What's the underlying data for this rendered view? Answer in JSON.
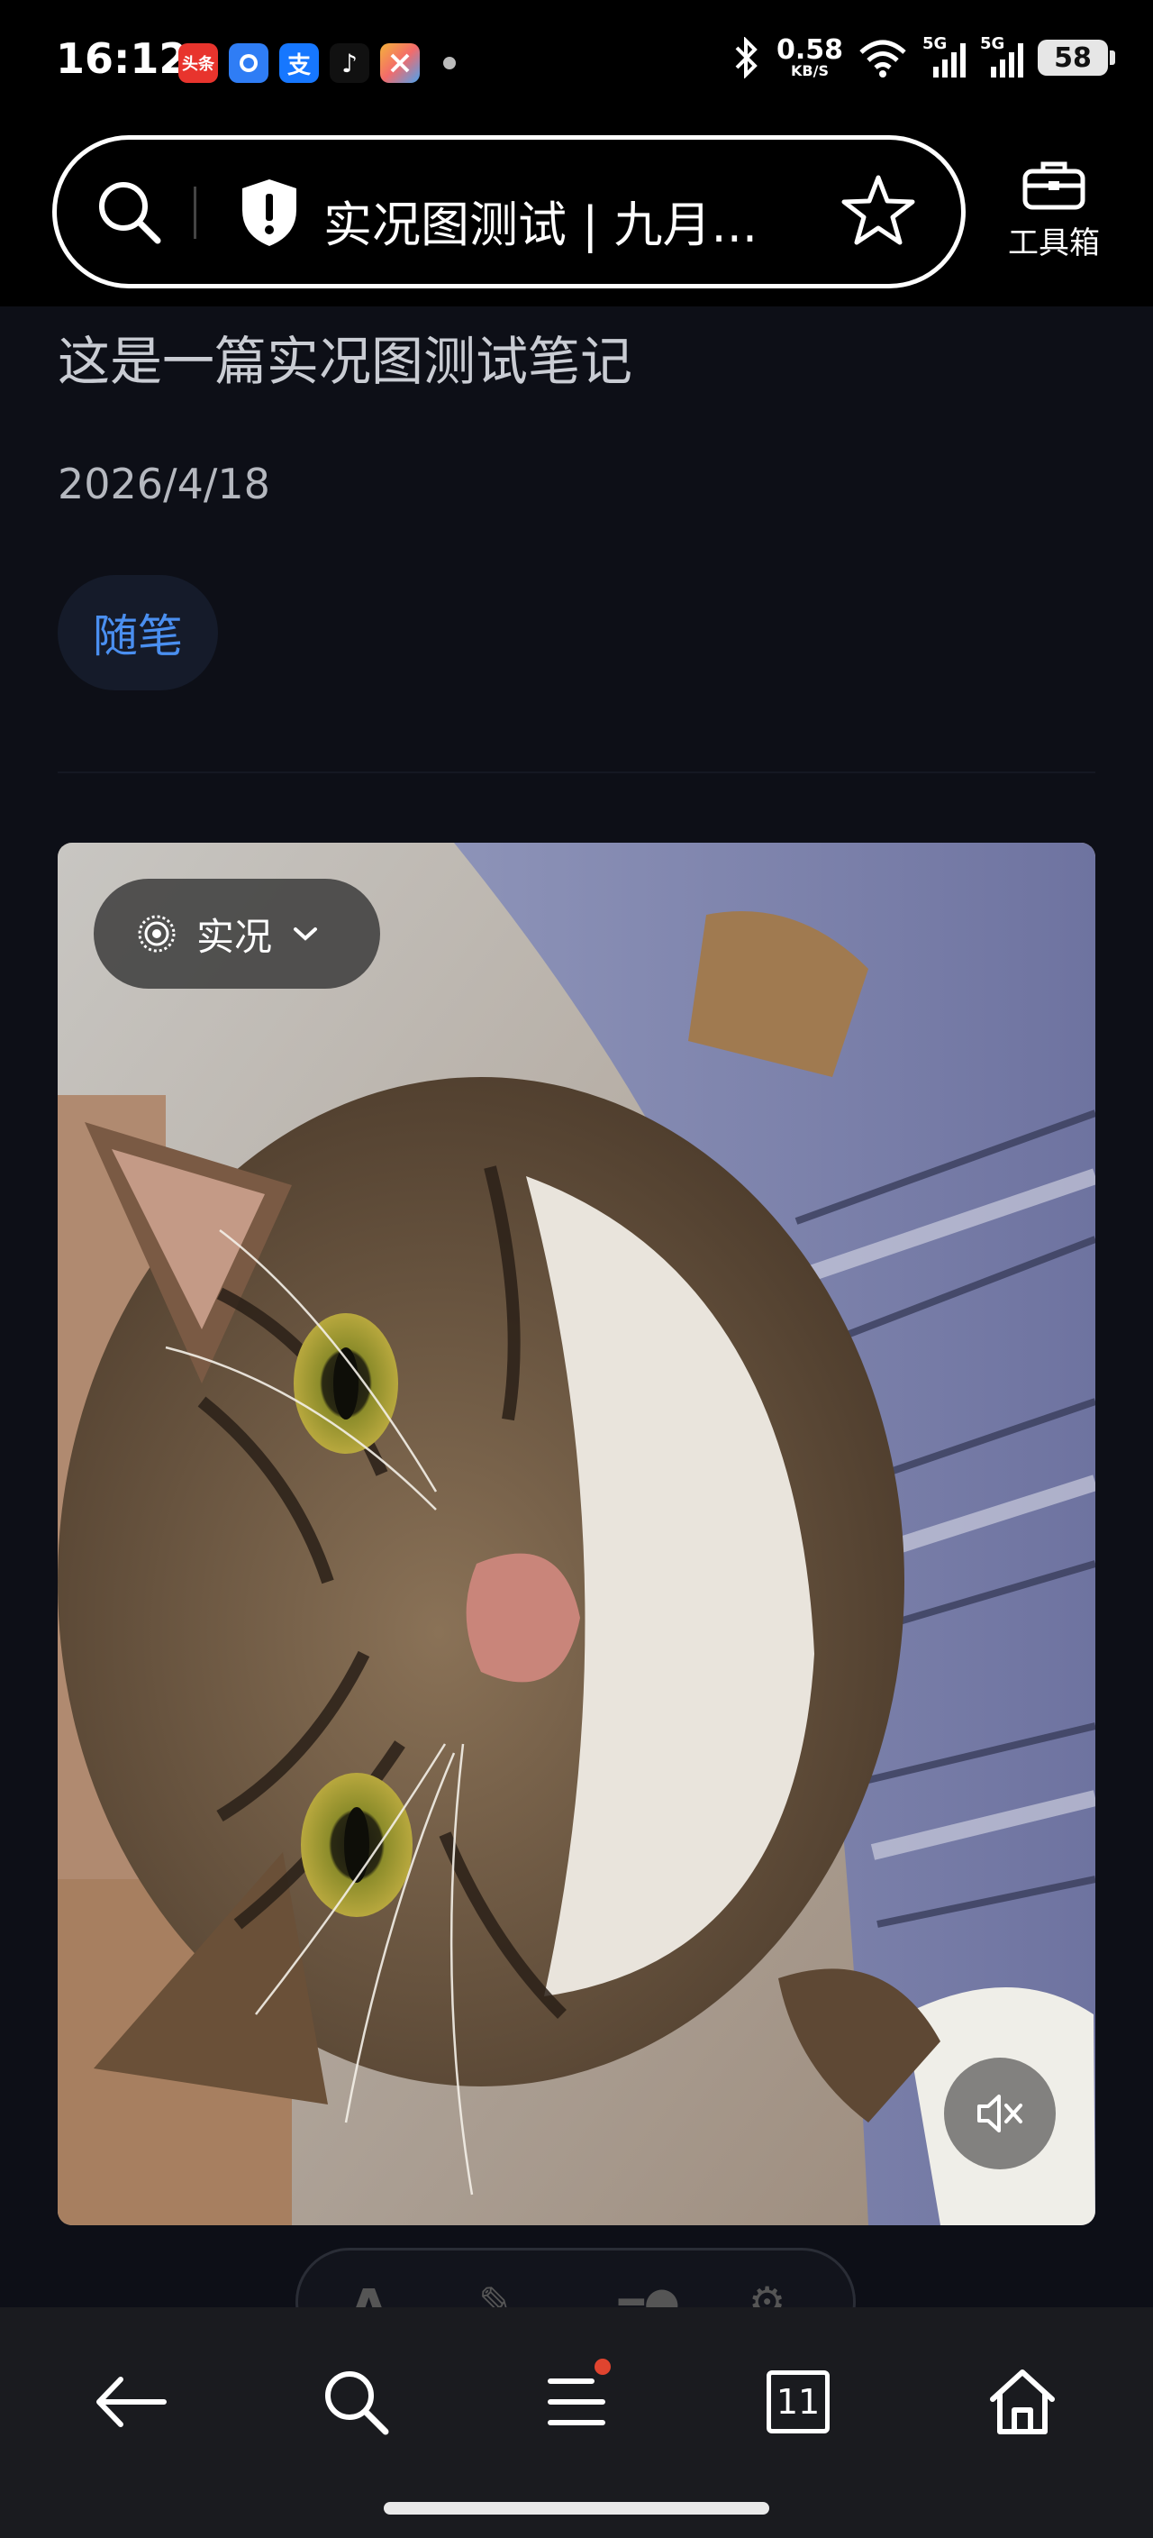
{
  "status_bar": {
    "time": "16:12",
    "app_icons": [
      {
        "name": "toutiao",
        "label": "头条",
        "color": "#e8342d"
      },
      {
        "name": "app-blue",
        "label": "",
        "color": "#2f7df5"
      },
      {
        "name": "alipay",
        "label": "支",
        "color": "#1677ff"
      },
      {
        "name": "tiktok",
        "label": "♪",
        "color": "#111111"
      },
      {
        "name": "app-colorful",
        "label": "",
        "color": "#f5b23a"
      }
    ],
    "net_speed": "0.58",
    "net_unit": "KB/S",
    "signal_1": "5G",
    "signal_2": "5G",
    "battery": "58"
  },
  "address_bar": {
    "page_title": "实况图测试 | 九月...",
    "toolbox_label": "工具箱"
  },
  "article": {
    "subtitle": "这是一篇实况图测试笔记",
    "date": "2026/4/18",
    "tag": "随笔"
  },
  "photo": {
    "live_label": "实况",
    "accent_tag_color": "#4a8ff0"
  },
  "bottom_nav": {
    "tab_count": "11",
    "icons": [
      "back-icon",
      "search-icon",
      "menu-icon",
      "tabs-icon",
      "home-icon"
    ]
  }
}
